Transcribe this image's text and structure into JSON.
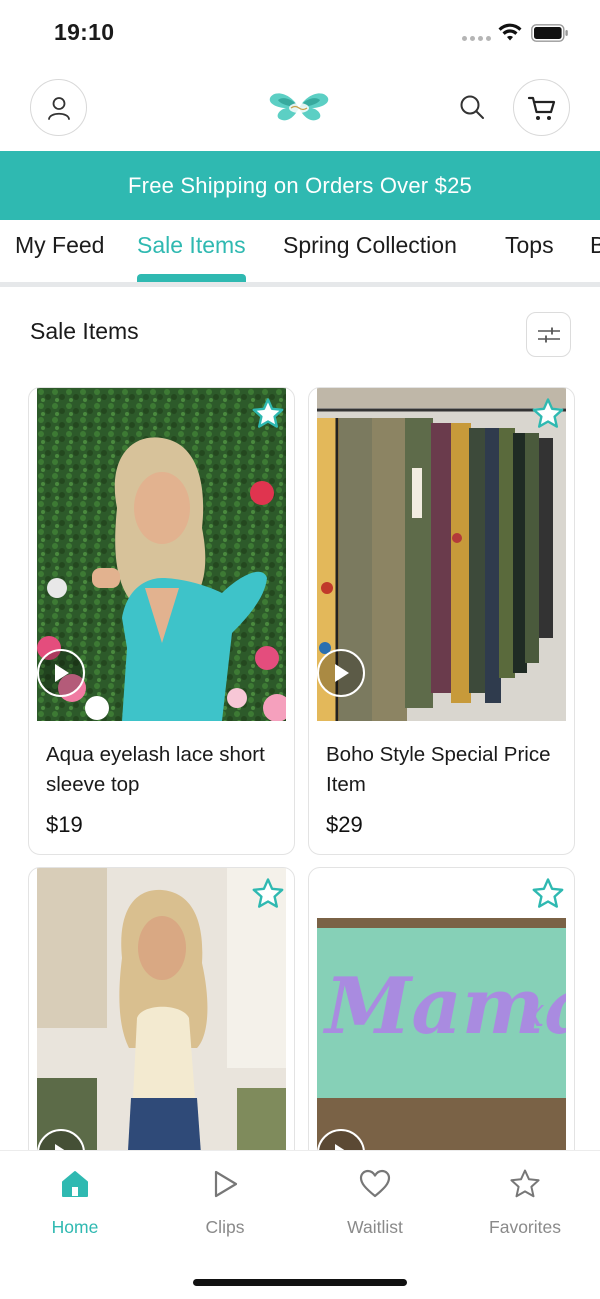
{
  "status_bar": {
    "time": "19:10"
  },
  "header": {
    "logo_icon": "butterfly-logo",
    "profile_icon": "user-icon",
    "search_icon": "search-icon",
    "cart_icon": "cart-icon"
  },
  "banner": {
    "text": "Free Shipping on Orders Over $25"
  },
  "tabs": [
    {
      "label": "My Feed",
      "active": false
    },
    {
      "label": "Sale Items",
      "active": true
    },
    {
      "label": "Spring Collection",
      "active": false
    },
    {
      "label": "Tops",
      "active": false
    },
    {
      "label": "B",
      "active": false
    }
  ],
  "section": {
    "title": "Sale Items",
    "filter_icon": "sliders-icon"
  },
  "products": [
    {
      "title": "Aqua eyelash lace short sleeve top",
      "price": "$19",
      "has_video": true
    },
    {
      "title": "Boho Style Special Price Item",
      "price": "$29",
      "has_video": true
    },
    {
      "title": "",
      "price": "",
      "has_video": true
    },
    {
      "title": "",
      "price": "",
      "has_video": true
    }
  ],
  "bottom_nav": {
    "items": [
      {
        "label": "Home",
        "icon": "home-icon",
        "active": true
      },
      {
        "label": "Clips",
        "icon": "play-icon",
        "active": false
      },
      {
        "label": "Waitlist",
        "icon": "heart-icon",
        "active": false
      },
      {
        "label": "Favorites",
        "icon": "star-icon",
        "active": false
      }
    ]
  },
  "colors": {
    "accent": "#2fb9b1",
    "text": "#1a1a1a",
    "muted": "#8a8a8a",
    "border": "#e3e3e3"
  }
}
